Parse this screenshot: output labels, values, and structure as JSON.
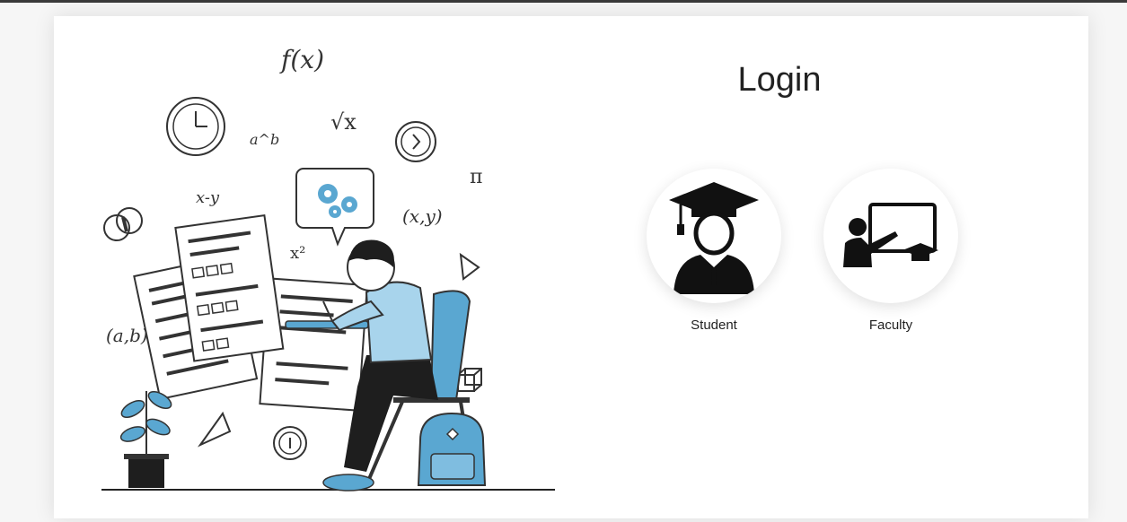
{
  "login": {
    "title": "Login"
  },
  "roles": [
    {
      "label": "Student",
      "icon": "student-graduate-icon"
    },
    {
      "label": "Faculty",
      "icon": "faculty-teacher-icon"
    }
  ],
  "illustration": {
    "math_symbols": [
      "f(x)",
      "a^b",
      "√x",
      "π",
      "x-y",
      "(x,y)",
      "x²",
      "(a,b)"
    ]
  },
  "colors": {
    "accent": "#5aa7d1",
    "dark": "#1a1a1a"
  }
}
